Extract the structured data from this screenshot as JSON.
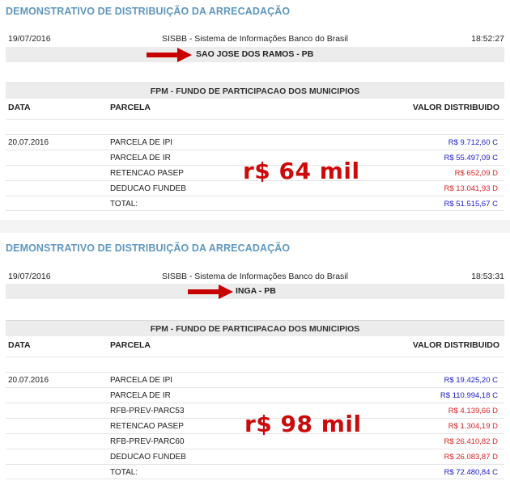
{
  "colors": {
    "heading": "#5f97c0",
    "credit": "#1a1ad0",
    "debit": "#e02020",
    "overlay": "#cc0a0a",
    "arrow": "#c80000"
  },
  "panels": [
    {
      "heading": "DEMONSTRATIVO DE DISTRIBUIÇÃO DA ARRECADAÇÃO",
      "date": "19/07/2016",
      "system": "SISBB - Sistema de Informações Banco do Brasil",
      "time": "18:52:27",
      "municipality": "SAO JOSE DOS RAMOS - PB",
      "section": "FPM - FUNDO DE PARTICIPACAO DOS MUNICIPIOS",
      "columns": {
        "data": "DATA",
        "parcela": "PARCELA",
        "valor": "VALOR DISTRIBUIDO"
      },
      "rows": [
        {
          "date": "",
          "parcela": "",
          "valor": "",
          "type": "blank"
        },
        {
          "date": "20.07.2016",
          "parcela": "PARCELA DE IPI",
          "valor": "R$ 9.712,60 C",
          "type": "credit"
        },
        {
          "date": "",
          "parcela": "PARCELA DE IR",
          "valor": "R$ 55.497,09 C",
          "type": "credit"
        },
        {
          "date": "",
          "parcela": "RETENCAO PASEP",
          "valor": "R$ 652,09 D",
          "type": "debit"
        },
        {
          "date": "",
          "parcela": "DEDUCAO FUNDEB",
          "valor": "R$ 13.041,93 D",
          "type": "debit"
        },
        {
          "date": "",
          "parcela": "TOTAL:",
          "valor": "R$ 51.515,67 C",
          "type": "credit"
        }
      ],
      "overlay": "r$ 64 mil"
    },
    {
      "heading": "DEMONSTRATIVO DE DISTRIBUIÇÃO DA ARRECADAÇÃO",
      "date": "19/07/2016",
      "system": "SISBB - Sistema de Informações Banco do Brasil",
      "time": "18:53:31",
      "municipality": "INGA - PB",
      "section": "FPM - FUNDO DE PARTICIPACAO DOS MUNICIPIOS",
      "columns": {
        "data": "DATA",
        "parcela": "PARCELA",
        "valor": "VALOR DISTRIBUIDO"
      },
      "rows": [
        {
          "date": "",
          "parcela": "",
          "valor": "",
          "type": "blank"
        },
        {
          "date": "20.07.2016",
          "parcela": "PARCELA DE IPI",
          "valor": "R$ 19.425,20 C",
          "type": "credit"
        },
        {
          "date": "",
          "parcela": "PARCELA DE IR",
          "valor": "R$ 110.994,18 C",
          "type": "credit"
        },
        {
          "date": "",
          "parcela": "RFB-PREV-PARC53",
          "valor": "R$ 4.139,66 D",
          "type": "debit"
        },
        {
          "date": "",
          "parcela": "RETENCAO PASEP",
          "valor": "R$ 1.304,19 D",
          "type": "debit"
        },
        {
          "date": "",
          "parcela": "RFB-PREV-PARC60",
          "valor": "R$ 26.410,82 D",
          "type": "debit"
        },
        {
          "date": "",
          "parcela": "DEDUCAO FUNDEB",
          "valor": "R$ 26.083,87 D",
          "type": "debit"
        },
        {
          "date": "",
          "parcela": "TOTAL:",
          "valor": "R$ 72.480,84 C",
          "type": "credit"
        }
      ],
      "overlay": "r$ 98 mil"
    }
  ]
}
